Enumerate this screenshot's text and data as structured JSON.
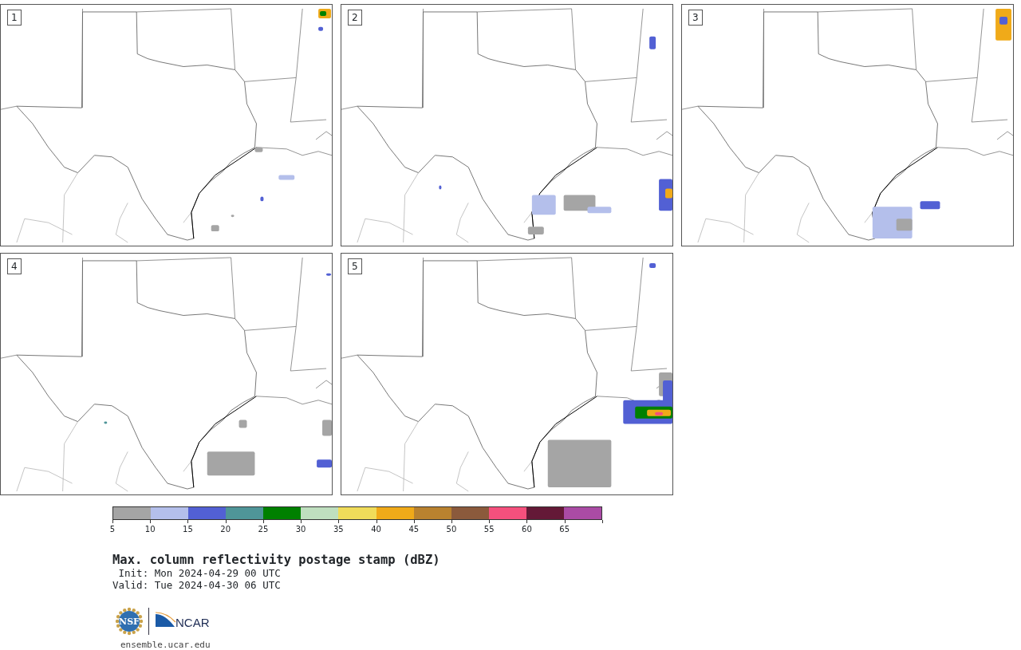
{
  "panels": [
    {
      "label": "1"
    },
    {
      "label": "2"
    },
    {
      "label": "3"
    },
    {
      "label": "4"
    },
    {
      "label": "5"
    }
  ],
  "colorbar": {
    "segments": [
      {
        "color": "#a5a5a5"
      },
      {
        "color": "#b4bfeb"
      },
      {
        "color": "#5260d4"
      },
      {
        "color": "#4f9598"
      },
      {
        "color": "#008000"
      },
      {
        "color": "#bfdfbf"
      },
      {
        "color": "#f0dc5a"
      },
      {
        "color": "#f0aa19"
      },
      {
        "color": "#b9822f"
      },
      {
        "color": "#8b5a3c"
      },
      {
        "color": "#f5507d"
      },
      {
        "color": "#641937"
      },
      {
        "color": "#aa4ba5"
      }
    ],
    "ticks": [
      "5",
      "10",
      "15",
      "20",
      "25",
      "30",
      "35",
      "40",
      "45",
      "50",
      "55",
      "60",
      "65"
    ]
  },
  "title": "Max. column reflectivity postage stamp (dBZ)",
  "init": " Init: Mon 2024-04-29 00 UTC",
  "valid": "Valid: Tue 2024-04-30 06 UTC",
  "logos": {
    "nsf": "NSF",
    "ncar": "NCAR"
  },
  "url": "ensemble.ucar.edu"
}
